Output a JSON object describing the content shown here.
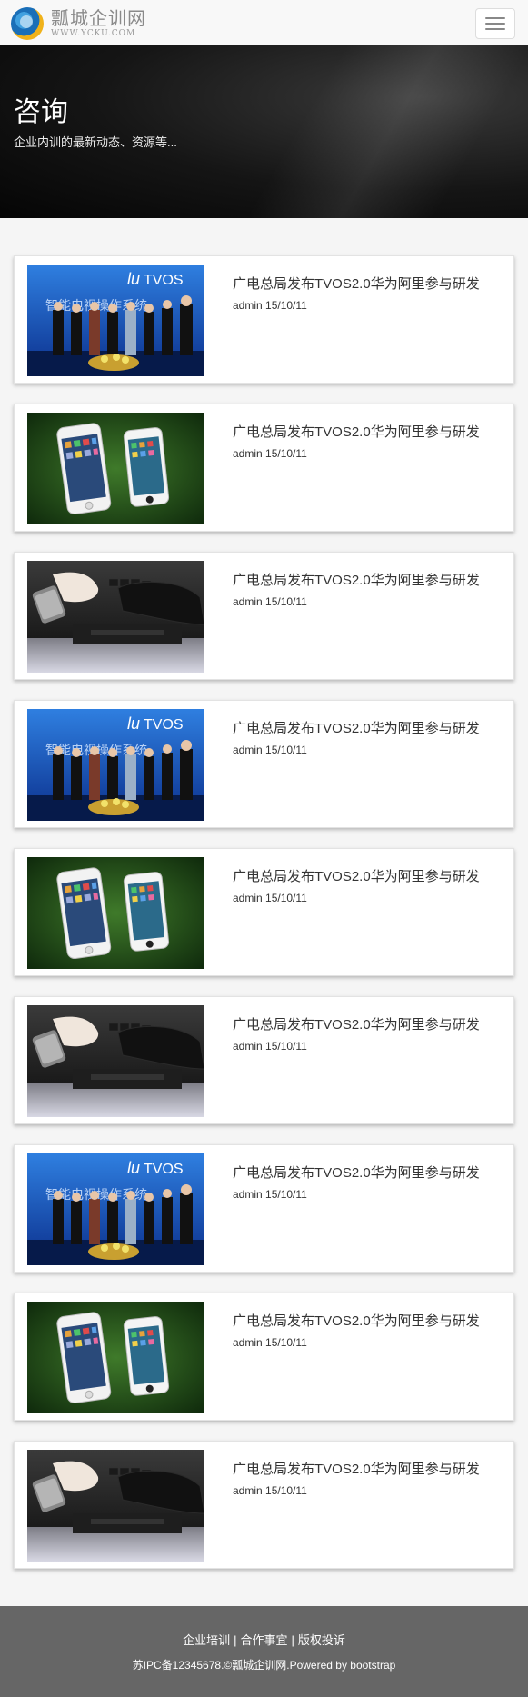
{
  "header": {
    "logo_cn": "瓢城企训网",
    "logo_en": "WWW.YCKU.COM",
    "menu_icon": "hamburger-menu-icon"
  },
  "banner": {
    "title": "咨询",
    "subtitle": "企业内训的最新动态、资源等..."
  },
  "articles": [
    {
      "title": "广电总局发布TVOS2.0华为阿里参与研发",
      "author": "admin",
      "date": "15/10/11",
      "image": "tvos-event-photo"
    },
    {
      "title": "广电总局发布TVOS2.0华为阿里参与研发",
      "author": "admin",
      "date": "15/10/11",
      "image": "iphones-on-grass-photo"
    },
    {
      "title": "广电总局发布TVOS2.0华为阿里参与研发",
      "author": "admin",
      "date": "15/10/11",
      "image": "gloved-hand-keyboard-photo"
    },
    {
      "title": "广电总局发布TVOS2.0华为阿里参与研发",
      "author": "admin",
      "date": "15/10/11",
      "image": "tvos-event-photo"
    },
    {
      "title": "广电总局发布TVOS2.0华为阿里参与研发",
      "author": "admin",
      "date": "15/10/11",
      "image": "iphones-on-grass-photo"
    },
    {
      "title": "广电总局发布TVOS2.0华为阿里参与研发",
      "author": "admin",
      "date": "15/10/11",
      "image": "gloved-hand-keyboard-photo"
    },
    {
      "title": "广电总局发布TVOS2.0华为阿里参与研发",
      "author": "admin",
      "date": "15/10/11",
      "image": "tvos-event-photo"
    },
    {
      "title": "广电总局发布TVOS2.0华为阿里参与研发",
      "author": "admin",
      "date": "15/10/11",
      "image": "iphones-on-grass-photo"
    },
    {
      "title": "广电总局发布TVOS2.0华为阿里参与研发",
      "author": "admin",
      "date": "15/10/11",
      "image": "gloved-hand-keyboard-photo"
    }
  ],
  "footer": {
    "links": [
      "企业培训",
      "合作事宜",
      "版权投诉"
    ],
    "separator": "|",
    "copyright": "苏IPC备12345678.©瓢城企训网.Powered by bootstrap"
  },
  "colors": {
    "header_bg": "#f8f8f8",
    "banner_bg": "#0b0b0b",
    "card_bg": "#ffffff",
    "footer_bg": "#666666",
    "text": "#333333"
  }
}
